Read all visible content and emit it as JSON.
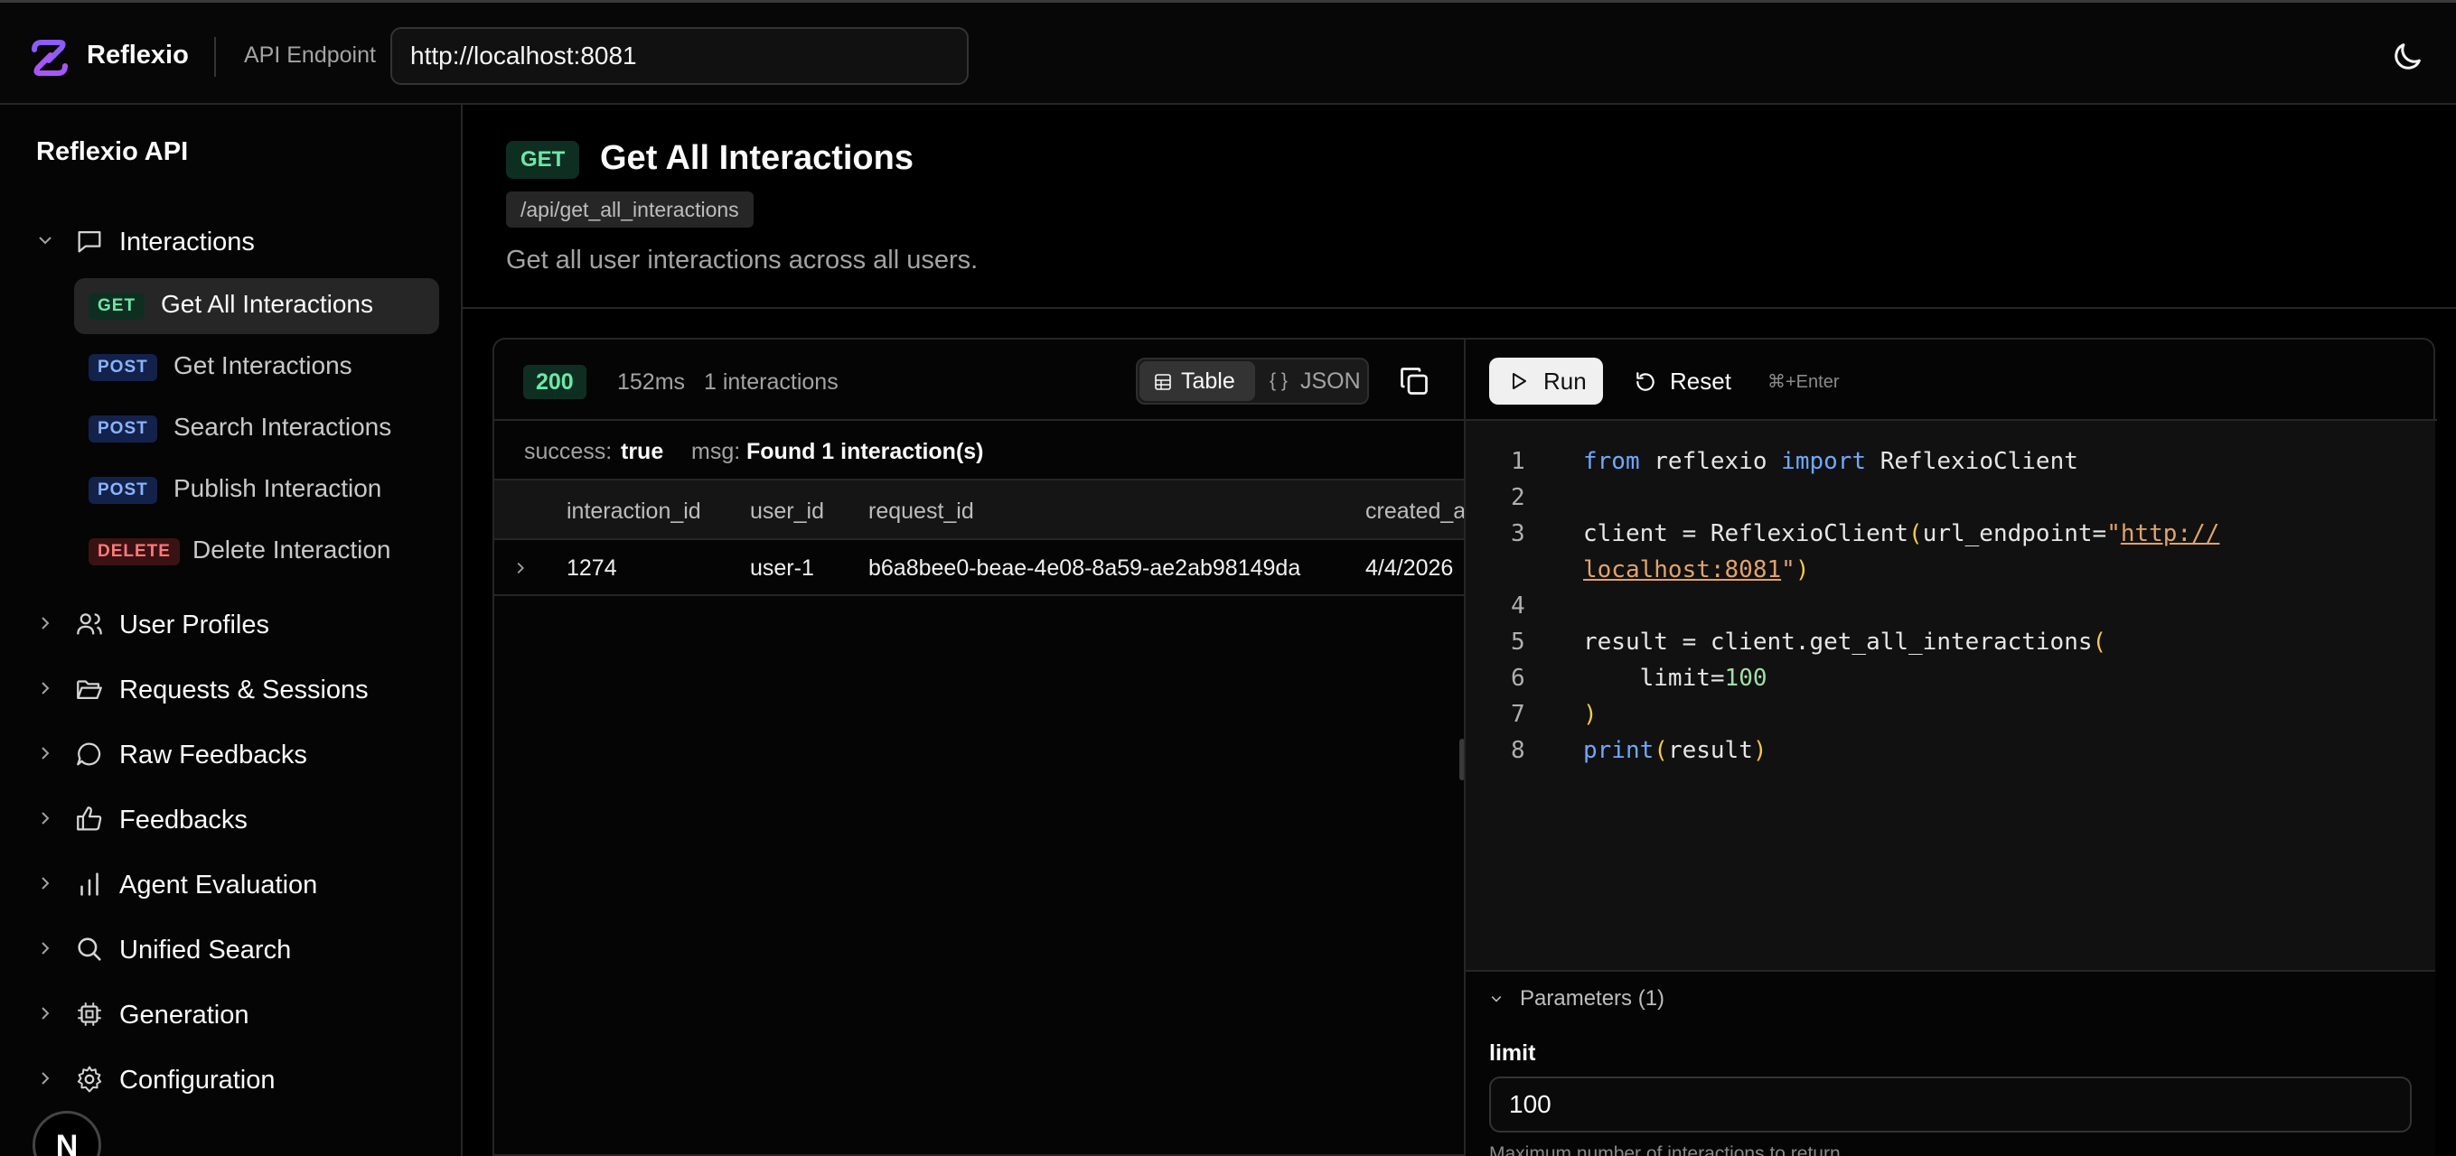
{
  "header": {
    "brand": "Reflexio",
    "api_endpoint_label": "API Endpoint",
    "api_endpoint_value": "http://localhost:8081"
  },
  "sidebar": {
    "title": "Reflexio API",
    "groups": [
      {
        "label": "Interactions",
        "icon": "message-square-icon",
        "expanded": true,
        "items": [
          {
            "method": "GET",
            "label": "Get All Interactions",
            "active": true
          },
          {
            "method": "POST",
            "label": "Get Interactions"
          },
          {
            "method": "POST",
            "label": "Search Interactions"
          },
          {
            "method": "POST",
            "label": "Publish Interaction"
          },
          {
            "method": "DELETE",
            "label": "Delete Interaction"
          }
        ]
      },
      {
        "label": "User Profiles",
        "icon": "users-icon"
      },
      {
        "label": "Requests & Sessions",
        "icon": "folder-open-icon"
      },
      {
        "label": "Raw Feedbacks",
        "icon": "message-circle-icon"
      },
      {
        "label": "Feedbacks",
        "icon": "thumbs-up-icon"
      },
      {
        "label": "Agent Evaluation",
        "icon": "bar-chart-icon"
      },
      {
        "label": "Unified Search",
        "icon": "search-icon"
      },
      {
        "label": "Generation",
        "icon": "cpu-icon"
      },
      {
        "label": "Configuration",
        "icon": "gear-icon"
      }
    ],
    "dev_badge": "N"
  },
  "endpoint": {
    "method": "GET",
    "title": "Get All Interactions",
    "path": "/api/get_all_interactions",
    "description": "Get all user interactions across all users."
  },
  "response": {
    "status": "200",
    "time": "152ms",
    "count": "1 interactions",
    "view_table": "Table",
    "view_json": "JSON",
    "view_json_icon": "{ }",
    "success_key": "success:",
    "success_value": "true",
    "msg_key": "msg:",
    "msg_value": "Found 1 interaction(s)",
    "columns": [
      "interaction_id",
      "user_id",
      "request_id",
      "created_a"
    ],
    "rows": [
      {
        "interaction_id": "1274",
        "user_id": "user-1",
        "request_id": "b6a8bee0-beae-4e08-8a59-ae2ab98149da",
        "created_at": "4/4/2026"
      }
    ]
  },
  "code": {
    "run_label": "Run",
    "reset_label": "Reset",
    "shortcut": "⌘+Enter",
    "line_numbers": [
      "1",
      "2",
      "3",
      "4",
      "5",
      "6",
      "7",
      "8"
    ],
    "tokens": {
      "l1_from": "from",
      "l1_mod": " reflexio ",
      "l1_import": "import",
      "l1_cls": " ReflexioClient",
      "l3_a": "client = ReflexioClient",
      "l3_p1": "(",
      "l3_b": "url_endpoint=",
      "l3_q1": "\"",
      "l3_url1": "http://",
      "l3c_url2": "localhost:8081",
      "l3c_q2": "\"",
      "l3c_p2": ")",
      "l5_a": "result = client.get_all_interactions",
      "l5_p": "(",
      "l6_a": "    limit=",
      "l6_n": "100",
      "l7_p": ")",
      "l8_fn": "print",
      "l8_p1": "(",
      "l8_a": "result",
      "l8_p2": ")"
    }
  },
  "params": {
    "toggle_label": "Parameters (1)",
    "name": "limit",
    "value": "100",
    "help": "Maximum number of interactions to return"
  },
  "colors": {
    "accent_purple": "#8b5cf6",
    "get_green": "#6ee7a6",
    "post_blue": "#8ab4ff",
    "delete_red": "#ff7a7a"
  }
}
